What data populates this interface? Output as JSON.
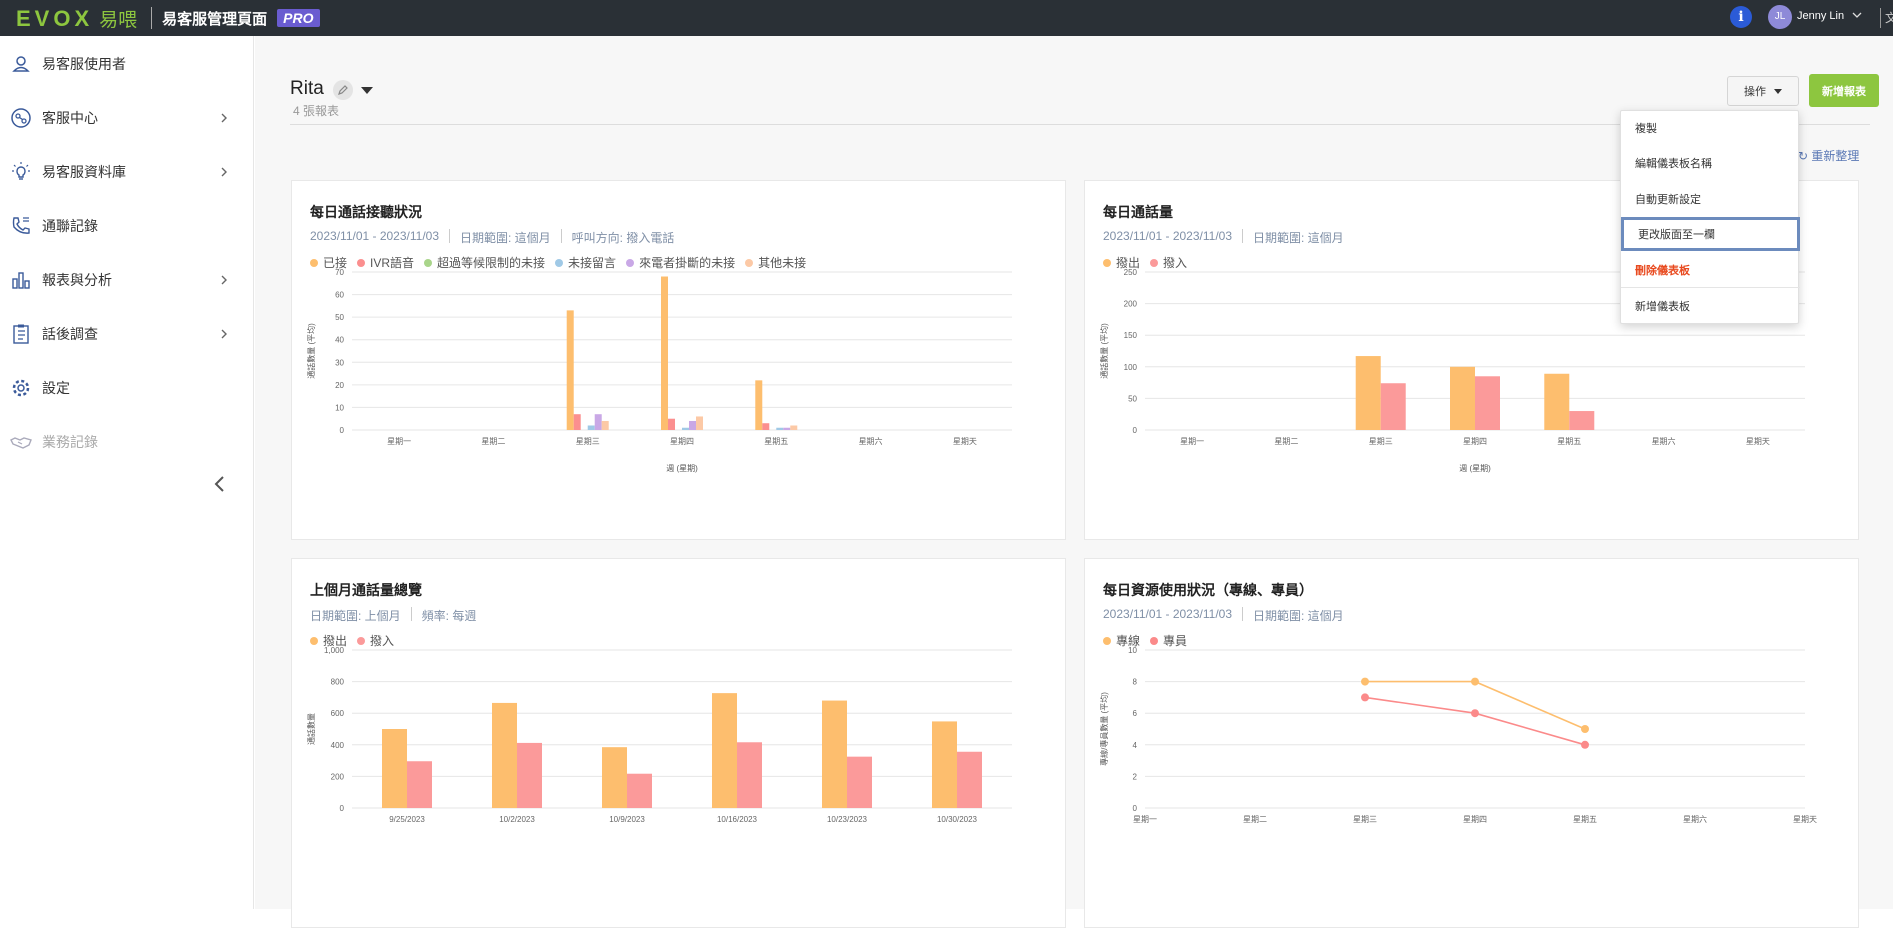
{
  "topbar": {
    "logo_text": "EVOX",
    "logo_cn": "易喂",
    "title": "易客服管理頁面",
    "badge": "PRO",
    "user_initials": "JL",
    "user_name": "Jenny Lin",
    "lang_glyph": "文"
  },
  "sidebar": {
    "items": [
      {
        "label": "易客服使用者",
        "icon": "user-icon",
        "has_children": false
      },
      {
        "label": "客服中心",
        "icon": "headset-icon",
        "has_children": true
      },
      {
        "label": "易客服資料庫",
        "icon": "lightbulb-icon",
        "has_children": true
      },
      {
        "label": "通聯記錄",
        "icon": "phone-log-icon",
        "has_children": false
      },
      {
        "label": "報表與分析",
        "icon": "bar-chart-icon",
        "has_children": true
      },
      {
        "label": "話後調查",
        "icon": "survey-icon",
        "has_children": true
      },
      {
        "label": "設定",
        "icon": "gear-icon",
        "has_children": false
      },
      {
        "label": "業務記錄",
        "icon": "handshake-icon",
        "has_children": false,
        "disabled": true
      }
    ]
  },
  "dashboard": {
    "title": "Rita",
    "subtitle": "4 張報表",
    "ops_label": "操作",
    "add_label": "新增報表",
    "refresh_label": "重新整理"
  },
  "menu": {
    "items": [
      {
        "label": "複製"
      },
      {
        "label": "編輯儀表板名稱"
      },
      {
        "label": "自動更新設定"
      },
      {
        "label": "更改版面至一欄",
        "selected": true
      },
      {
        "label": "刪除儀表板",
        "danger": true
      },
      {
        "label": "新增儀表板"
      }
    ]
  },
  "cards": [
    {
      "title": "每日通話接聽狀況",
      "meta": [
        "2023/11/01 - 2023/11/03",
        "日期範圍: 這個月",
        "呼叫方向: 撥入電話"
      ]
    },
    {
      "title": "每日通話量",
      "meta": [
        "2023/11/01 - 2023/11/03",
        "日期範圍: 這個月"
      ]
    },
    {
      "title": "上個月通話量總覽",
      "meta": [
        "日期範圍: 上個月",
        "頻率: 每週"
      ]
    },
    {
      "title": "每日資源使用狀況（專線、專員）",
      "meta": [
        "2023/11/01 - 2023/11/03",
        "日期範圍: 這個月"
      ]
    }
  ],
  "chart_data": [
    {
      "type": "bar",
      "categories": [
        "星期一",
        "星期二",
        "星期三",
        "星期四",
        "星期五",
        "星期六",
        "星期天"
      ],
      "series": [
        {
          "name": "已接",
          "color": "#fdbe6e",
          "values": [
            0,
            0,
            53,
            68,
            22,
            0,
            0
          ]
        },
        {
          "name": "IVR語音",
          "color": "#fb8f8f",
          "values": [
            0,
            0,
            7,
            5,
            3,
            0,
            0
          ]
        },
        {
          "name": "超過等候限制的未接",
          "color": "#a9d58a",
          "values": [
            0,
            0,
            0,
            0,
            0,
            0,
            0
          ]
        },
        {
          "name": "未接留言",
          "color": "#a0c9e6",
          "values": [
            0,
            0,
            2,
            1,
            1,
            0,
            0
          ]
        },
        {
          "name": "來電者掛斷的未接",
          "color": "#c9a8e6",
          "values": [
            0,
            0,
            7,
            4,
            1,
            0,
            0
          ]
        },
        {
          "name": "其他未接",
          "color": "#fcc9a6",
          "values": [
            0,
            0,
            4,
            6,
            2,
            0,
            0
          ]
        }
      ],
      "xlabel": "週 (星期)",
      "ylabel": "通話數量 (平均)",
      "ylim": [
        0,
        70
      ],
      "yticks": [
        0,
        10,
        20,
        30,
        40,
        50,
        60,
        70
      ],
      "grid": true,
      "legend": "top-left"
    },
    {
      "type": "bar",
      "categories": [
        "星期一",
        "星期二",
        "星期三",
        "星期四",
        "星期五",
        "星期六",
        "星期天"
      ],
      "series": [
        {
          "name": "撥出",
          "color": "#fdbe6e",
          "values": [
            0,
            0,
            117,
            100,
            89,
            0,
            0
          ]
        },
        {
          "name": "撥入",
          "color": "#fb9a9a",
          "values": [
            0,
            0,
            74,
            85,
            30,
            0,
            0
          ]
        }
      ],
      "xlabel": "週 (星期)",
      "ylabel": "通話數量 (平均)",
      "ylim": [
        0,
        250
      ],
      "yticks": [
        0,
        50,
        100,
        150,
        200,
        250
      ],
      "grid": true,
      "legend": "top-left"
    },
    {
      "type": "bar",
      "categories": [
        "9/25/2023",
        "10/2/2023",
        "10/9/2023",
        "10/16/2023",
        "10/23/2023",
        "10/30/2023"
      ],
      "series": [
        {
          "name": "撥出",
          "color": "#fdbe6e",
          "values": [
            500,
            665,
            385,
            727,
            680,
            548
          ]
        },
        {
          "name": "撥入",
          "color": "#fb9a9a",
          "values": [
            296,
            412,
            217,
            416,
            325,
            356
          ]
        }
      ],
      "xlabel": "",
      "ylabel": "通話數量",
      "ylim": [
        0,
        1000
      ],
      "yticks": [
        "0",
        "200",
        "400",
        "600",
        "800",
        "1,000"
      ],
      "grid": true,
      "legend": "top-left"
    },
    {
      "type": "line",
      "categories": [
        "星期一",
        "星期二",
        "星期三",
        "星期四",
        "星期五",
        "星期六",
        "星期天"
      ],
      "series": [
        {
          "name": "專線",
          "color": "#fdbe6e",
          "values": [
            null,
            null,
            8,
            8,
            5,
            null,
            null
          ]
        },
        {
          "name": "專員",
          "color": "#fb8a8a",
          "values": [
            null,
            null,
            7,
            6,
            4,
            null,
            null
          ]
        }
      ],
      "xlabel": "",
      "ylabel": "專線/專員數量 (平均)",
      "ylim": [
        0,
        10
      ],
      "yticks": [
        0,
        2,
        4,
        6,
        8,
        10
      ],
      "grid": true,
      "legend": "top-left"
    }
  ]
}
